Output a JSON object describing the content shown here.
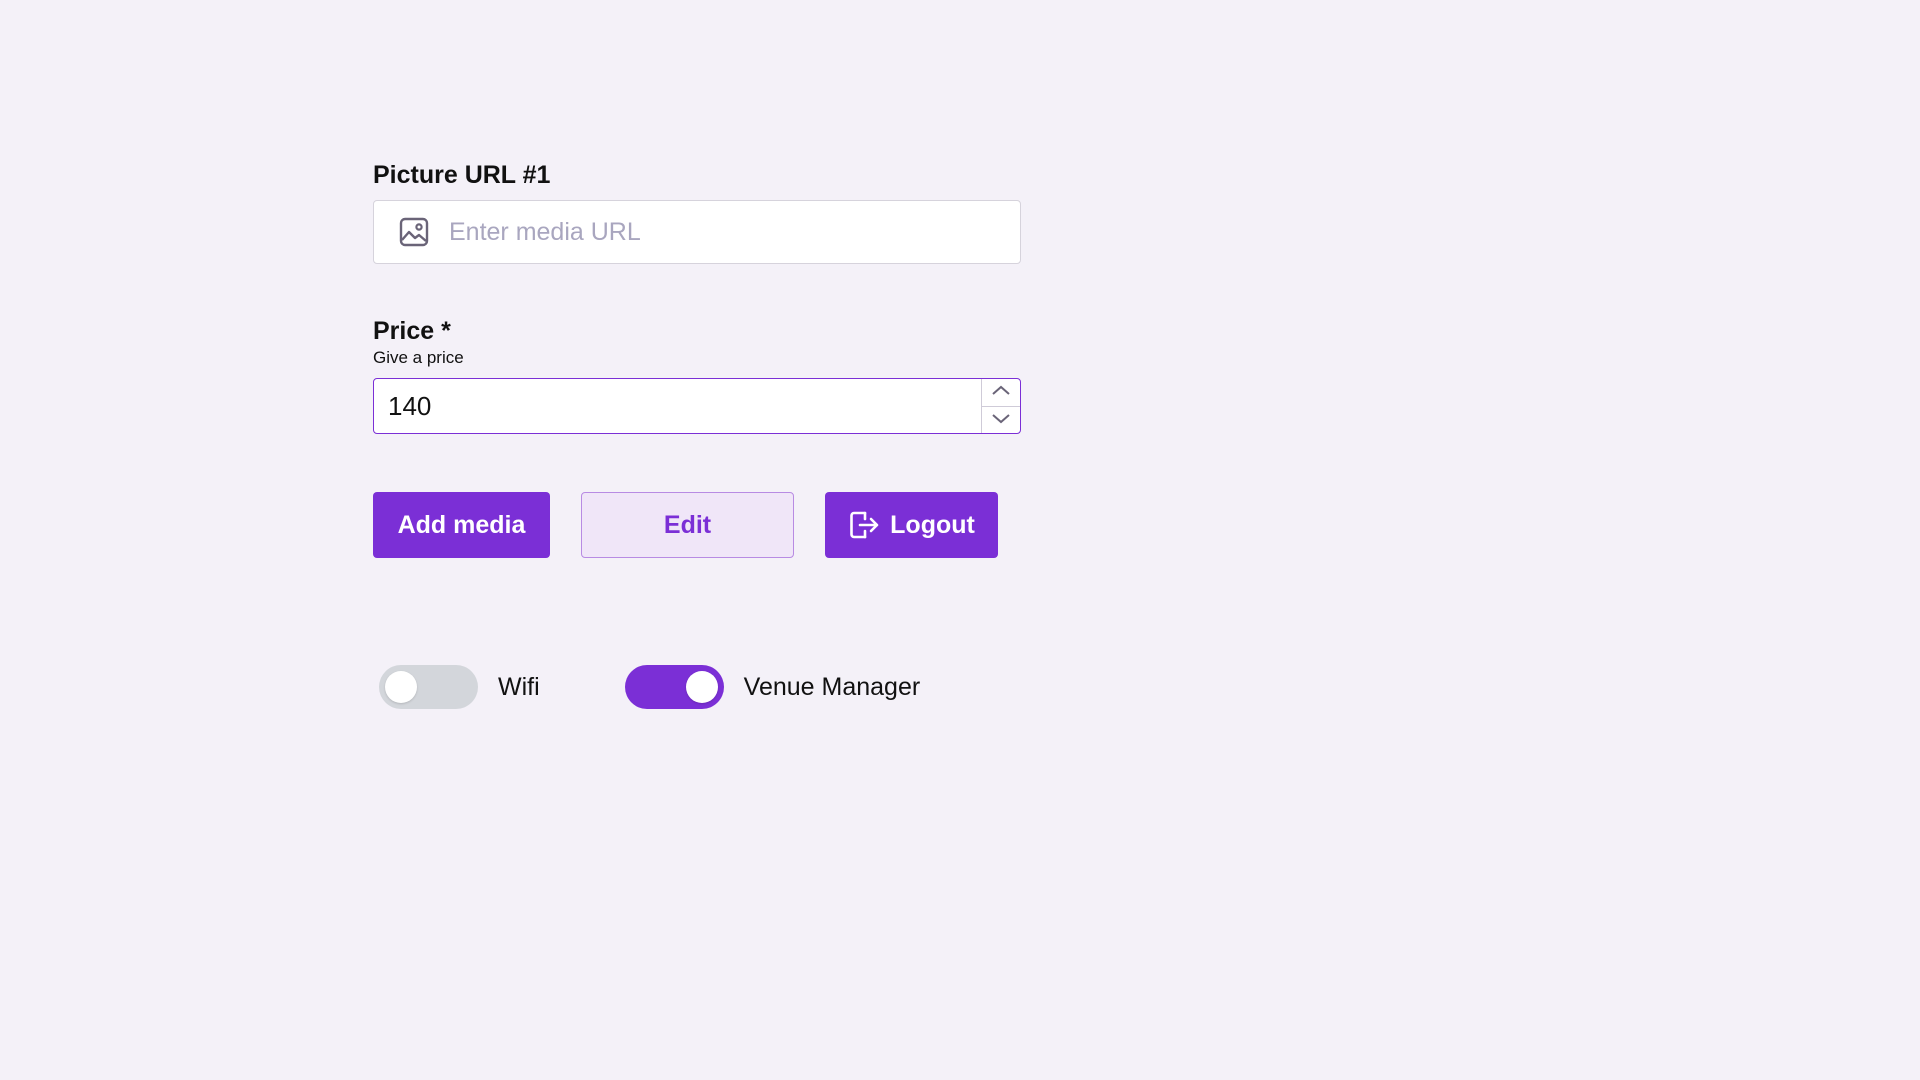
{
  "colors": {
    "background": "#f4f1f8",
    "accent": "#7b2fd6",
    "secondary_bg": "#f0e6f8",
    "placeholder": "#a9a6bf"
  },
  "picture_url": {
    "label": "Picture URL #1",
    "placeholder": "Enter media URL",
    "value": "",
    "icon": "image-icon"
  },
  "price": {
    "label": "Price *",
    "helper": "Give a price",
    "value": "140",
    "stepper_icons": [
      "chevron-up-icon",
      "chevron-down-icon"
    ]
  },
  "buttons": {
    "add_media": "Add media",
    "edit": "Edit",
    "logout": "Logout",
    "logout_icon": "logout-icon"
  },
  "toggles": {
    "wifi": {
      "label": "Wifi",
      "checked": false
    },
    "venue_manager": {
      "label": "Venue Manager",
      "checked": true
    }
  }
}
